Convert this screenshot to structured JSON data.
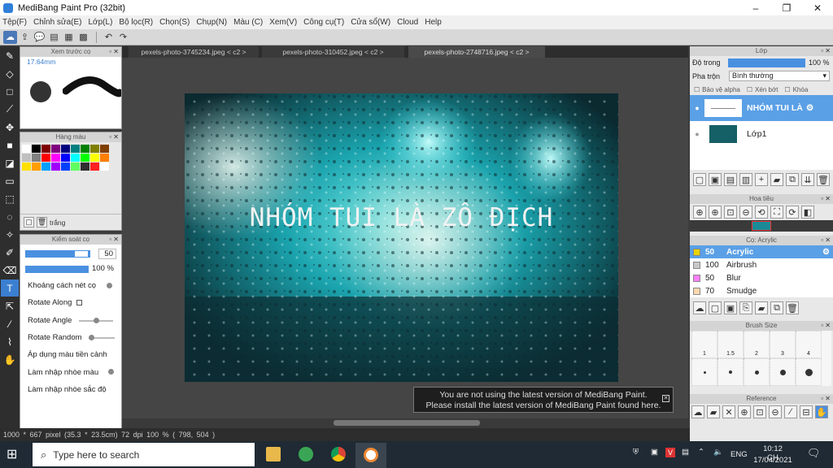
{
  "window": {
    "title": "MediBang Paint Pro (32bit)",
    "controls": [
      "–",
      "❐",
      "✕"
    ]
  },
  "menu": [
    "Tệp(F)",
    "Chỉnh sửa(E)",
    "Lớp(L)",
    "Bộ lọc(R)",
    "Chọn(S)",
    "Chụp(N)",
    "Màu (C)",
    "Xem(V)",
    "Công cụ(T)",
    "Cửa sổ(W)",
    "Cloud",
    "Help"
  ],
  "toolbar": {
    "icons": [
      "cloud-icon",
      "share-icon",
      "comment-icon",
      "page-icon",
      "layers-icon",
      "grid-icon",
      "undo-icon",
      "redo-icon"
    ]
  },
  "preview": {
    "title": "Xem trước cọ",
    "size_label": "17.64mm"
  },
  "palette": {
    "title": "Hàng màu",
    "colors": [
      "#ffffff",
      "#000000",
      "#7f0000",
      "#7f007f",
      "#00007f",
      "#007f7f",
      "#007f00",
      "#7f7f00",
      "#7f3f00",
      "#c0c0c0",
      "#808080",
      "#ff0000",
      "#ff00ff",
      "#0000ff",
      "#00ffff",
      "#00ff00",
      "#ffff00",
      "#ff8000",
      "#ffe000",
      "#ffa000",
      "#00a0ff",
      "#a000ff",
      "#0040ff",
      "#60ff60",
      "#303030",
      "#ff2020",
      "#ffffff"
    ],
    "footer_label": "trắng"
  },
  "brush_control": {
    "title": "Kiểm soát cọ",
    "size_value": "50",
    "opacity_value": "100 %",
    "options": [
      "Khoảng cách nét cọ",
      "Rotate Along",
      "Rotate Angle",
      "Rotate Random",
      "Áp dụng màu tiền cảnh",
      "Làm nhập nhòe màu",
      "Làm nhập nhòe sắc độ"
    ]
  },
  "tabs": [
    "pexels-photo-3745234.jpeg < c2 >",
    "pexels-photo-310452.jpeg < c2 >",
    "pexels-photo-2748716.jpeg < c2 >"
  ],
  "canvas": {
    "overlay_text": "NHÓM TUI LÀ ZÔ ĐỊCH"
  },
  "notice": {
    "line1": "You are not using the latest version of MediBang Paint.",
    "line2": "Please install the latest version of MediBang Paint found here."
  },
  "status": "1000 * 667 pixel  (35.3 * 23.5cm)  72 dpi  100 %  ( 798, 504 )",
  "layers": {
    "title": "Lớp",
    "opacity_label": "Độ trong",
    "opacity_value": "100 %",
    "blend_label": "Pha trộn",
    "blend_value": "Bình thường",
    "protect_alpha": "Bảo vệ alpha",
    "clipping": "Xén bớt",
    "lock": "Khóa",
    "items": [
      {
        "name": "NHÓM TUI LÀ",
        "selected": true
      },
      {
        "name": "Lớp1",
        "selected": false
      }
    ]
  },
  "navigator": {
    "title": "Hoa tiêu"
  },
  "brushes": {
    "title": "Cọ: Acrylic",
    "items": [
      {
        "size": "50",
        "name": "Acrylic",
        "color": "#e8d400",
        "selected": true
      },
      {
        "size": "100",
        "name": "Airbrush",
        "color": "#c8c8c8",
        "selected": false
      },
      {
        "size": "50",
        "name": "Blur",
        "color": "#ff80ff",
        "selected": false
      },
      {
        "size": "70",
        "name": "Smudge",
        "color": "#ffd8b0",
        "selected": false
      }
    ]
  },
  "brush_size": {
    "title": "Brush Size",
    "labels": [
      "1",
      "1.5",
      "2",
      "3",
      "4"
    ]
  },
  "reference": {
    "title": "Reference"
  },
  "taskbar": {
    "search_placeholder": "Type here to search",
    "lang": "ENG",
    "time": "10:12 CH",
    "date": "17/04/2021"
  }
}
